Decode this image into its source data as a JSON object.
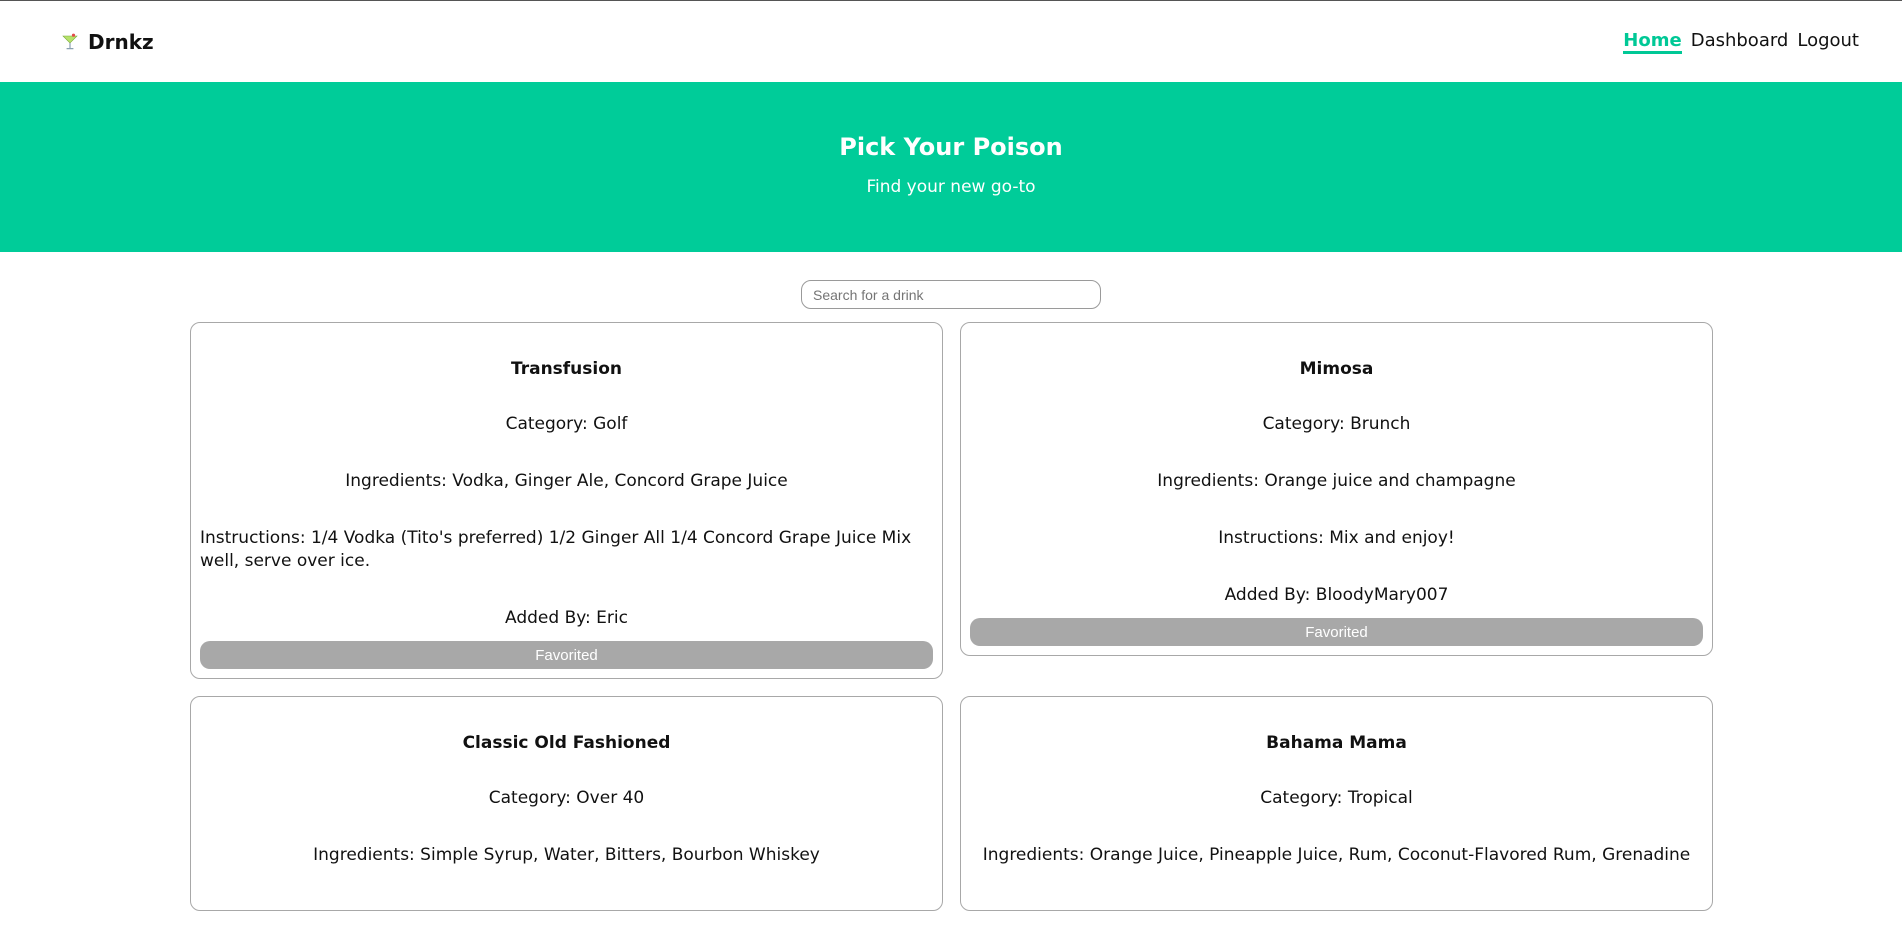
{
  "navbar": {
    "brand": "Drnkz",
    "links": [
      {
        "label": "Home"
      },
      {
        "label": "Dashboard"
      },
      {
        "label": "Logout"
      }
    ]
  },
  "hero": {
    "title": "Pick Your Poison",
    "subtitle": "Find your new go-to"
  },
  "search": {
    "placeholder": "Search for a drink",
    "value": ""
  },
  "drinks": [
    {
      "name": "Transfusion",
      "category": "Category: Golf",
      "ingredients": "Ingredients: Vodka, Ginger Ale, Concord Grape Juice",
      "instructions": "Instructions: 1/4 Vodka (Tito's preferred) 1/2 Ginger All 1/4 Concord Grape Juice Mix well, serve over ice.",
      "added_by": "Added By: Eric",
      "button": "Favorited"
    },
    {
      "name": "Mimosa",
      "category": "Category: Brunch",
      "ingredients": "Ingredients: Orange juice and champagne",
      "instructions": "Instructions: Mix and enjoy!",
      "added_by": "Added By: BloodyMary007",
      "button": "Favorited"
    },
    {
      "name": "Classic Old Fashioned",
      "category": "Category: Over 40",
      "ingredients": "Ingredients: Simple Syrup, Water, Bitters, Bourbon Whiskey"
    },
    {
      "name": "Bahama Mama",
      "category": "Category: Tropical",
      "ingredients": "Ingredients: Orange Juice, Pineapple Juice, Rum, Coconut-Flavored Rum, Grenadine"
    }
  ],
  "colors": {
    "accent": "#00cc99",
    "button_disabled": "#a8a8a8"
  },
  "icons": {
    "brand": "cocktail-glass-icon"
  }
}
